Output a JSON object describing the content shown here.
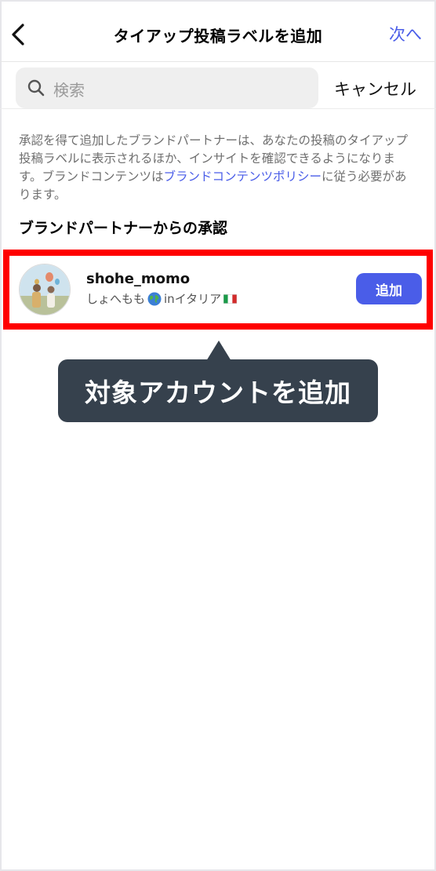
{
  "header": {
    "title": "タイアップ投稿ラベルを追加",
    "next_label": "次へ"
  },
  "search": {
    "placeholder": "検索",
    "cancel_label": "キャンセル"
  },
  "description": {
    "text_before_link": "承認を得て追加したブランドパートナーは、あなたの投稿のタイアップ投稿ラベルに表示されるほか、インサイトを確認できるようになります。ブランドコンテンツは",
    "link_text": "ブランドコンテンツポリシー",
    "text_after_link": "に従う必要があります。"
  },
  "section": {
    "title": "ブランドパートナーからの承認"
  },
  "partner": {
    "username": "shohe_momo",
    "display_name_prefix": "しょへもも",
    "display_name_suffix": "inイタリア",
    "add_label": "追加"
  },
  "annotation": {
    "tooltip_text": "対象アカウントを追加",
    "highlight_color": "#ff0000"
  },
  "colors": {
    "accent": "#4a5de8",
    "tooltip_bg": "#36414d"
  },
  "icons": {
    "back": "chevron-left-icon",
    "search": "search-icon",
    "globe": "globe-emoji-icon",
    "flag": "italy-flag-icon"
  }
}
